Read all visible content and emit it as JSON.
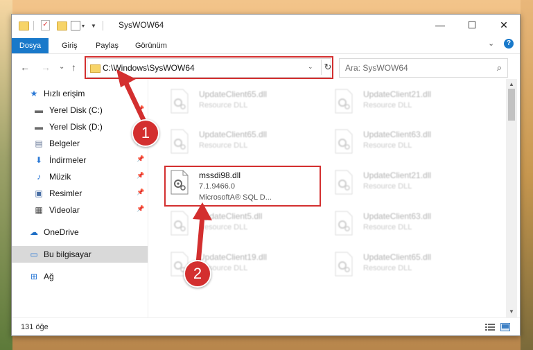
{
  "window": {
    "title": "SysWOW64",
    "minimize_glyph": "—",
    "maximize_glyph": "☐",
    "close_glyph": "✕"
  },
  "ribbon": {
    "tabs": [
      "Dosya",
      "Giriş",
      "Paylaş",
      "Görünüm"
    ],
    "expand_glyph": "⌄",
    "help_glyph": "?"
  },
  "address": {
    "path": "C:\\Windows\\SysWOW64",
    "back_glyph": "←",
    "forward_glyph": "→",
    "recent_glyph": "⌄",
    "up_glyph": "↑",
    "dropdown_glyph": "⌄",
    "refresh_glyph": "↻"
  },
  "search": {
    "placeholder": "Ara: SysWOW64",
    "icon_glyph": "⌕"
  },
  "sidebar": {
    "items": [
      {
        "label": "Hızlı erişim",
        "icon": "star-icon",
        "glyph": "★",
        "color": "#2b79d6"
      },
      {
        "label": "Yerel Disk (C:)",
        "icon": "drive-icon",
        "glyph": "▬",
        "color": "#6a6a6a"
      },
      {
        "label": "Yerel Disk (D:)",
        "icon": "drive-icon",
        "glyph": "▬",
        "color": "#6a6a6a"
      },
      {
        "label": "Belgeler",
        "icon": "documents-icon",
        "glyph": "▤",
        "color": "#6b7b9a"
      },
      {
        "label": "İndirmeler",
        "icon": "download-icon",
        "glyph": "⬇",
        "color": "#2b79d6"
      },
      {
        "label": "Müzik",
        "icon": "music-icon",
        "glyph": "♪",
        "color": "#2b79d6"
      },
      {
        "label": "Resimler",
        "icon": "pictures-icon",
        "glyph": "▣",
        "color": "#4a6fa5"
      },
      {
        "label": "Videolar",
        "icon": "videos-icon",
        "glyph": "▦",
        "color": "#444444"
      },
      {
        "label": "OneDrive",
        "icon": "cloud-icon",
        "glyph": "☁",
        "color": "#1f6fc5"
      },
      {
        "label": "Bu bilgisayar",
        "icon": "computer-icon",
        "glyph": "▭",
        "color": "#2b79d6"
      },
      {
        "label": "Ağ",
        "icon": "network-icon",
        "glyph": "⊞",
        "color": "#2b79d6"
      }
    ],
    "pin_glyph": "📌"
  },
  "files": {
    "left": [
      {
        "name": "UpdateClient65.dll",
        "type": "Resource DLL"
      },
      {
        "name": "UpdateClient65.dll",
        "type": "Resource DLL"
      },
      {
        "name": "mssdi98.dll",
        "version": "7.1.9466.0",
        "company": "MicrosoftA® SQL D..."
      },
      {
        "name": "UpdateClient5.dll",
        "type": "Resource DLL"
      },
      {
        "name": "UpdateClient19.dll",
        "type": "Resource DLL"
      }
    ],
    "right": [
      {
        "name": "UpdateClient21.dll",
        "type": "Resource DLL"
      },
      {
        "name": "UpdateClient63.dll",
        "type": "Resource DLL"
      },
      {
        "name": "UpdateClient21.dll",
        "type": "Resource DLL"
      },
      {
        "name": "UpdateClient63.dll",
        "type": "Resource DLL"
      },
      {
        "name": "UpdateClient65.dll",
        "type": "Resource DLL"
      }
    ]
  },
  "status": {
    "count": "131 öğe"
  },
  "annotations": {
    "badge1": "1",
    "badge2": "2",
    "highlight_color": "#d32f2f"
  }
}
